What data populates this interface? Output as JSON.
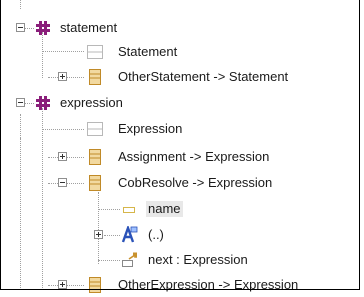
{
  "tree": {
    "items": [
      {
        "label": "statement",
        "icon": "grammar-rule-icon",
        "toggle": "expanded"
      },
      {
        "label": "Statement",
        "icon": "abstract-class-icon"
      },
      {
        "label": "OtherStatement -> Statement",
        "icon": "class-icon",
        "toggle": "collapsed"
      },
      {
        "label": "expression",
        "icon": "grammar-rule-icon",
        "toggle": "expanded"
      },
      {
        "label": "Expression",
        "icon": "abstract-class-icon"
      },
      {
        "label": "Assignment -> Expression",
        "icon": "class-icon",
        "toggle": "collapsed"
      },
      {
        "label": "CobResolve -> Expression",
        "icon": "class-icon",
        "toggle": "expanded"
      },
      {
        "label": "name",
        "icon": "attribute-icon"
      },
      {
        "label": "(..)",
        "icon": "alternative-icon",
        "toggle": "collapsed"
      },
      {
        "label": "next : Expression",
        "icon": "reference-icon"
      },
      {
        "label": "OtherExpression -> Expression",
        "icon": "class-icon",
        "toggle": "collapsed"
      }
    ]
  },
  "colors": {
    "rule": "#8a1e7a",
    "class_fill": "#f2d9a0",
    "class_border": "#c08a28",
    "alternative": "#2a52b8",
    "reference": "#c9922e",
    "attribute": "#d6b64a"
  }
}
